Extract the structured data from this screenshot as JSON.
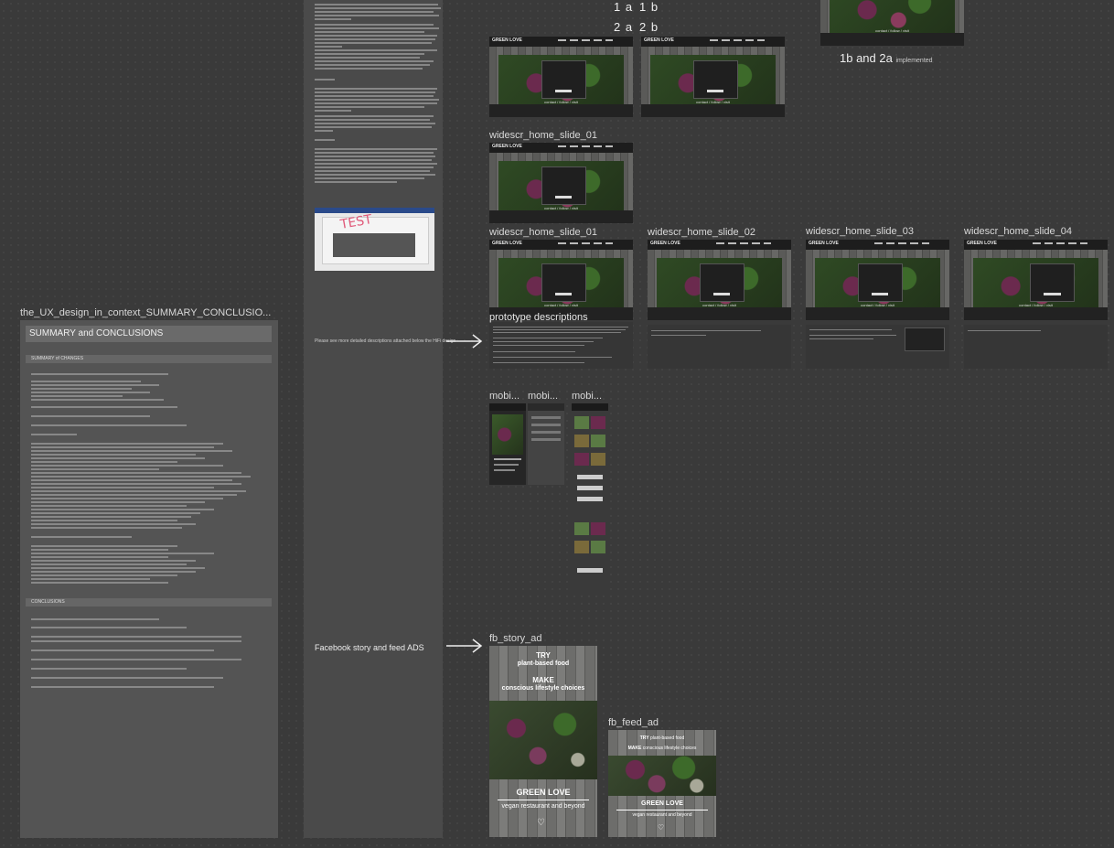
{
  "labels": {
    "top_1a": "1 a",
    "top_1b": "1 b",
    "top_2a": "2 a",
    "top_2b": "2 b",
    "implemented_main": "1b and 2a",
    "implemented_sub": "implemented",
    "slide01_a": "widescr_home_slide_01",
    "slide01_b": "widescr_home_slide_01",
    "slide02": "widescr_home_slide_02",
    "slide03": "widescr_home_slide_03",
    "slide04": "widescr_home_slide_04",
    "prototype_descriptions": "prototype descriptions",
    "mobile_1": "mobi...",
    "mobile_2": "mobi...",
    "mobile_3": "mobi...",
    "fb_story": "fb_story_ad",
    "fb_feed": "fb_feed_ad",
    "summary_frame": "the_UX_design_in_context_SUMMARY_CONCLUSIO..."
  },
  "summary": {
    "header": "SUMMARY and CONCLUSIONS",
    "section_1": "SUMMARY of CHANGES",
    "section_2": "CONCLUSIONS"
  },
  "notes": {
    "caption_prototype": "Please see more detailed descriptions attached below the HiFi design",
    "caption_facebook": "Facebook story and feed ADS",
    "test_stamp": "TEST"
  },
  "site": {
    "logo": "GREEN LOVE",
    "footer": "contact / follow / visit"
  },
  "ads": {
    "try": "TRY",
    "plant_based": "plant-based food",
    "make": "MAKE",
    "conscious": "conscious lifestyle choices",
    "brand": "GREEN LOVE",
    "tagline": "vegan restaurant and beyond"
  }
}
